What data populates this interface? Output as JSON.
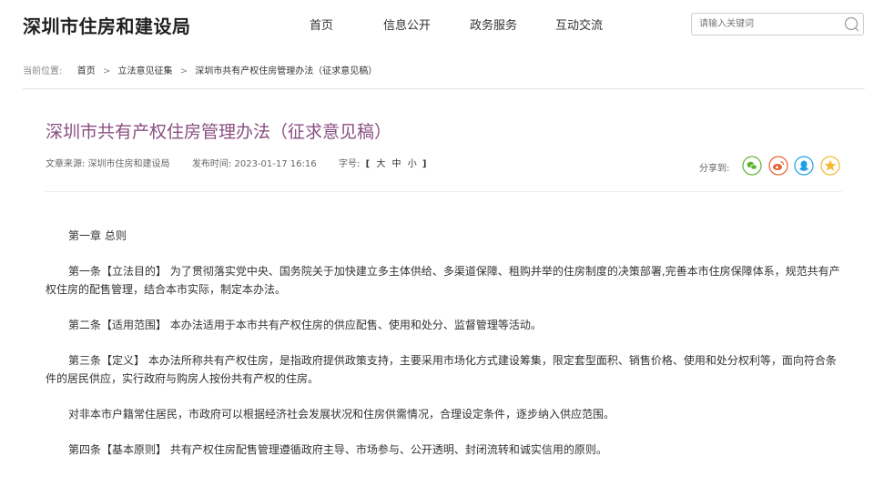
{
  "header": {
    "site_title": "深圳市住房和建设局",
    "nav": [
      "首页",
      "信息公开",
      "政务服务",
      "互动交流"
    ],
    "search_placeholder": "请输入关键词"
  },
  "breadcrumb": {
    "label": "当前位置:",
    "items": [
      "首页",
      "立法意见征集",
      "深圳市共有产权住房管理办法（征求意见稿）"
    ],
    "separator": ">"
  },
  "article": {
    "title": "深圳市共有产权住房管理办法（征求意见稿）",
    "source_label": "文章来源:",
    "source": "深圳市住房和建设局",
    "time_label": "发布时间:",
    "time": "2023-01-17 16:16",
    "font_label": "字号:",
    "font_open": "[",
    "font_sizes": [
      "大",
      "中",
      "小"
    ],
    "font_close": "]"
  },
  "share": {
    "label": "分享到:",
    "icons": [
      "wechat-icon",
      "weibo-icon",
      "qq-icon",
      "qzone-icon"
    ],
    "colors": [
      "#5cb531",
      "#e6612f",
      "#1ea0e8",
      "#f5b82e"
    ]
  },
  "content": {
    "paragraphs": [
      "第一章 总则",
      "第一条【立法目的】 为了贯彻落实党中央、国务院关于加快建立多主体供给、多渠道保障、租购并举的住房制度的决策部署,完善本市住房保障体系，规范共有产权住房的配售管理，结合本市实际，制定本办法。",
      "第二条【适用范围】 本办法适用于本市共有产权住房的供应配售、使用和处分、监督管理等活动。",
      "第三条【定义】 本办法所称共有产权住房，是指政府提供政策支持，主要采用市场化方式建设筹集，限定套型面积、销售价格、使用和处分权利等，面向符合条件的居民供应，实行政府与购房人按份共有产权的住房。",
      "对非本市户籍常住居民，市政府可以根据经济社会发展状况和住房供需情况，合理设定条件，逐步纳入供应范围。",
      "第四条【基本原则】 共有产权住房配售管理遵循政府主导、市场参与、公开透明、封闭流转和诚实信用的原则。"
    ]
  }
}
